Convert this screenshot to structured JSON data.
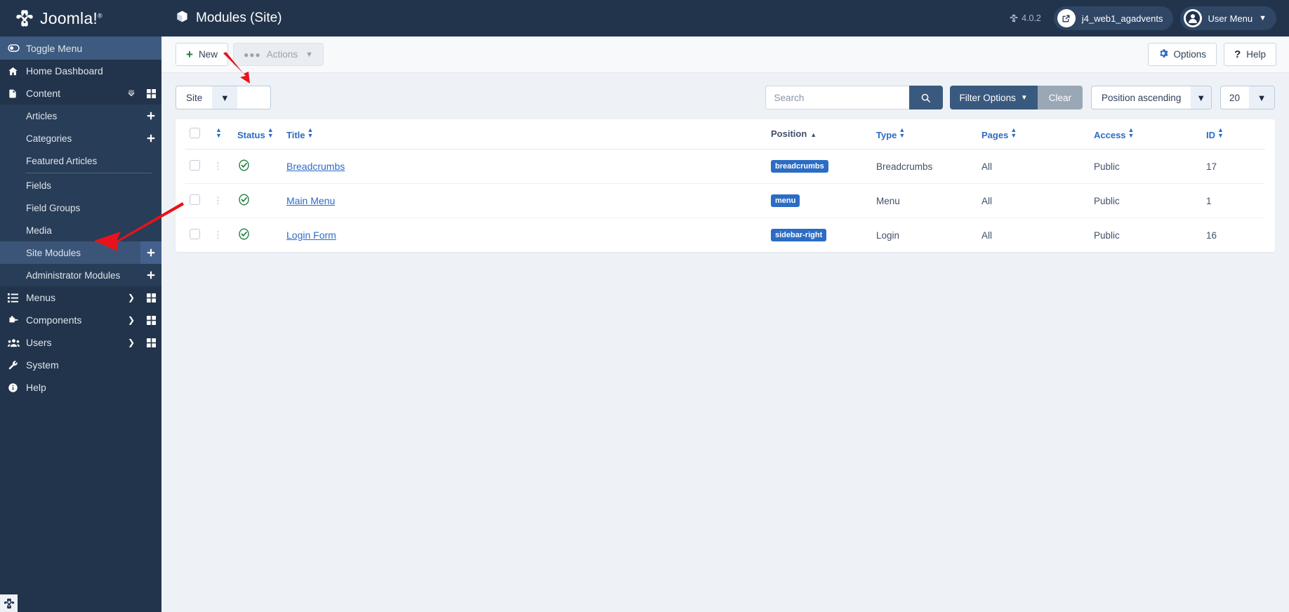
{
  "brand": {
    "name": "Joomla!",
    "trademark": "®"
  },
  "sidebar": {
    "toggle_label": "Toggle Menu",
    "items": [
      {
        "label": "Home Dashboard",
        "icon": "home-icon"
      },
      {
        "label": "Content",
        "icon": "document-icon"
      },
      {
        "label": "Articles",
        "icon": "none"
      },
      {
        "label": "Categories",
        "icon": "none"
      },
      {
        "label": "Featured Articles",
        "icon": "none"
      },
      {
        "label": "Fields",
        "icon": "none"
      },
      {
        "label": "Field Groups",
        "icon": "none"
      },
      {
        "label": "Media",
        "icon": "none"
      },
      {
        "label": "Site Modules",
        "icon": "none"
      },
      {
        "label": "Administrator Modules",
        "icon": "none"
      },
      {
        "label": "Menus",
        "icon": "list-icon"
      },
      {
        "label": "Components",
        "icon": "puzzle-icon"
      },
      {
        "label": "Users",
        "icon": "users-icon"
      },
      {
        "label": "System",
        "icon": "wrench-icon"
      },
      {
        "label": "Help",
        "icon": "info-icon"
      }
    ]
  },
  "header": {
    "title": "Modules (Site)",
    "title_icon": "cube-icon",
    "version": "4.0.2",
    "site_name": "j4_web1_agadvents",
    "site_icon": "external-link-icon",
    "user_menu": "User Menu",
    "user_icon": "user-circle-icon"
  },
  "toolbar": {
    "new_label": "New",
    "actions_label": "Actions",
    "options_label": "Options",
    "help_label": "Help"
  },
  "filters": {
    "client_select": "Site",
    "search_placeholder": "Search",
    "search_value": "",
    "filter_options_label": "Filter Options",
    "clear_label": "Clear",
    "ordering": "Position ascending",
    "limit": "20"
  },
  "table": {
    "columns": [
      {
        "key": "check",
        "label": "",
        "sortable": false
      },
      {
        "key": "ordering",
        "label": "",
        "sortable": true
      },
      {
        "key": "status",
        "label": "Status",
        "sortable": true
      },
      {
        "key": "title",
        "label": "Title",
        "sortable": true
      },
      {
        "key": "position",
        "label": "Position",
        "sortable": true,
        "active_sort": "ascending"
      },
      {
        "key": "type",
        "label": "Type",
        "sortable": true
      },
      {
        "key": "pages",
        "label": "Pages",
        "sortable": true
      },
      {
        "key": "access",
        "label": "Access",
        "sortable": true
      },
      {
        "key": "id",
        "label": "ID",
        "sortable": true
      }
    ],
    "rows": [
      {
        "status": "published",
        "title": "Breadcrumbs",
        "position": "breadcrumbs",
        "type": "Breadcrumbs",
        "pages": "All",
        "access": "Public",
        "id": "17"
      },
      {
        "status": "published",
        "title": "Main Menu",
        "position": "menu",
        "type": "Menu",
        "pages": "All",
        "access": "Public",
        "id": "1"
      },
      {
        "status": "published",
        "title": "Login Form",
        "position": "sidebar-right",
        "type": "Login",
        "pages": "All",
        "access": "Public",
        "id": "16"
      }
    ]
  },
  "colors": {
    "sidebar_bg": "#22344b",
    "sidebar_sub_bg": "#283d57",
    "sidebar_active": "#3a5578",
    "accent_blue": "#2c6cc4",
    "dark_blue_btn": "#39597f",
    "status_green": "#1a7d3c",
    "arrow_red": "#e8131a"
  }
}
